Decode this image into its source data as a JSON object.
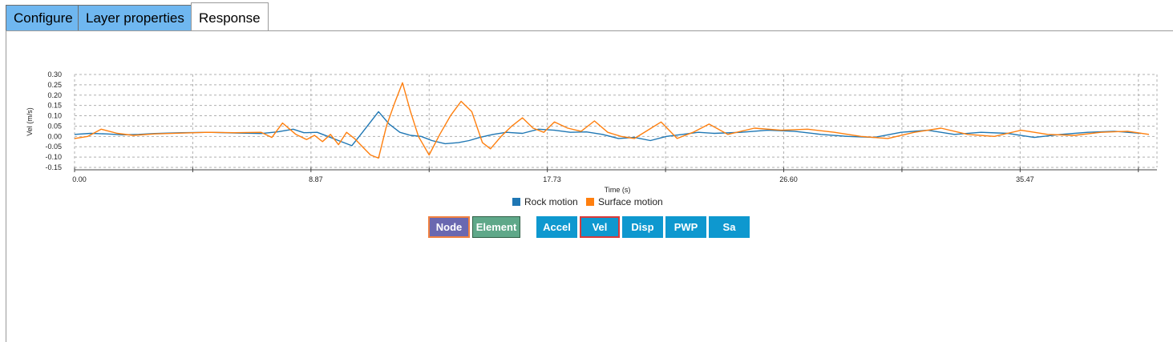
{
  "tabs": [
    {
      "label": "Configure",
      "active": false
    },
    {
      "label": "Layer properties",
      "active": false
    },
    {
      "label": "Response",
      "active": true
    }
  ],
  "buttons": {
    "node": "Node",
    "element": "Element",
    "accel": "Accel",
    "vel": "Vel",
    "disp": "Disp",
    "pwp": "PWP",
    "sa": "Sa"
  },
  "colors": {
    "tab_inactive": "#6fb7f0",
    "node_button": "#6a68b0",
    "element_button": "#5fa889",
    "response_button": "#0e98cf",
    "selected_outline": "#f08040",
    "vel_outline": "#d83a3a",
    "rock_series": "#1f77b4",
    "surface_series": "#ff7f0e"
  },
  "chart_data": {
    "type": "line",
    "xlabel": "Time (s)",
    "ylabel": "Vel (m/s)",
    "xlim": [
      0,
      40.6
    ],
    "ylim": [
      -0.15,
      0.3
    ],
    "x_ticks": [
      "0.00",
      "8.87",
      "17.73",
      "26.60",
      "35.47"
    ],
    "y_ticks": [
      "0.30",
      "0.25",
      "0.20",
      "0.15",
      "0.10",
      "0.05",
      "0.00",
      "-0.05",
      "-0.10",
      "-0.15"
    ],
    "grid": true,
    "legend_position": "bottom",
    "series": [
      {
        "name": "Rock motion",
        "x": [
          0,
          0.6,
          1.2,
          1.8,
          2.4,
          3.0,
          4.0,
          5.0,
          6.0,
          7.0,
          7.6,
          8.2,
          8.6,
          9.1,
          9.5,
          9.9,
          10.4,
          10.8,
          11.1,
          11.4,
          11.8,
          12.2,
          12.6,
          13.0,
          13.4,
          13.9,
          14.4,
          14.8,
          15.2,
          15.7,
          16.2,
          16.8,
          17.4,
          18.0,
          18.6,
          19.2,
          19.8,
          20.4,
          21.0,
          21.6,
          22.2,
          22.8,
          23.4,
          24.0,
          25.0,
          26.0,
          27.0,
          28.0,
          29.0,
          30.0,
          31.0,
          32.0,
          33.0,
          34.0,
          35.0,
          36.0,
          37.0,
          38.0,
          39.0,
          40.0
        ],
        "values": [
          0.01,
          0.015,
          0.012,
          0.008,
          0.01,
          0.014,
          0.018,
          0.02,
          0.017,
          0.014,
          0.022,
          0.035,
          0.018,
          0.02,
          0.0,
          -0.02,
          -0.045,
          0.02,
          0.07,
          0.12,
          0.06,
          0.02,
          0.005,
          0.0,
          -0.02,
          -0.035,
          -0.03,
          -0.02,
          -0.005,
          0.01,
          0.02,
          0.015,
          0.035,
          0.03,
          0.02,
          0.022,
          0.01,
          -0.01,
          -0.005,
          -0.02,
          0.0,
          0.01,
          0.02,
          0.015,
          0.02,
          0.03,
          0.025,
          0.01,
          0.0,
          -0.005,
          0.02,
          0.03,
          0.01,
          0.02,
          0.015,
          -0.005,
          0.01,
          0.02,
          0.025,
          0.015
        ]
      },
      {
        "name": "Surface motion",
        "x": [
          0,
          0.5,
          1.0,
          1.6,
          2.2,
          3.0,
          4.0,
          5.0,
          6.0,
          7.0,
          7.4,
          7.8,
          8.3,
          8.7,
          9.0,
          9.3,
          9.6,
          9.9,
          10.2,
          10.5,
          10.8,
          11.1,
          11.4,
          11.7,
          12.0,
          12.3,
          12.6,
          12.9,
          13.3,
          13.7,
          14.1,
          14.5,
          14.9,
          15.3,
          15.6,
          16.0,
          16.4,
          16.8,
          17.2,
          17.6,
          18.0,
          18.5,
          19.0,
          19.5,
          20.0,
          20.5,
          21.0,
          21.5,
          22.0,
          22.6,
          23.2,
          23.8,
          24.5,
          25.5,
          26.5,
          27.5,
          28.5,
          29.5,
          30.5,
          31.5,
          32.5,
          33.5,
          34.5,
          35.5,
          36.5,
          37.5,
          38.5,
          39.5,
          40.3
        ],
        "values": [
          -0.01,
          0.0,
          0.035,
          0.015,
          0.005,
          0.012,
          0.016,
          0.02,
          0.018,
          0.02,
          -0.005,
          0.065,
          0.01,
          -0.015,
          0.005,
          -0.025,
          0.01,
          -0.04,
          0.02,
          -0.01,
          -0.05,
          -0.09,
          -0.105,
          0.05,
          0.16,
          0.26,
          0.12,
          0.0,
          -0.09,
          0.01,
          0.1,
          0.17,
          0.12,
          -0.03,
          -0.06,
          0.0,
          0.05,
          0.09,
          0.04,
          0.02,
          0.07,
          0.04,
          0.025,
          0.075,
          0.02,
          0.0,
          -0.01,
          0.03,
          0.07,
          -0.01,
          0.02,
          0.06,
          0.01,
          0.04,
          0.03,
          0.035,
          0.02,
          0.0,
          -0.01,
          0.02,
          0.04,
          0.01,
          0.0,
          0.03,
          0.01,
          0.005,
          0.02,
          0.025,
          0.01
        ]
      }
    ]
  }
}
